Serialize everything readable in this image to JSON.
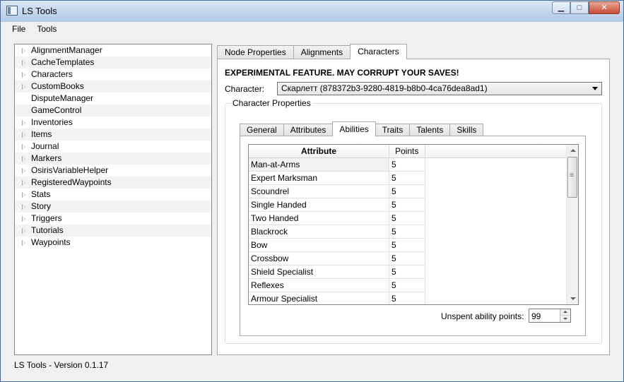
{
  "window": {
    "title": "LS Tools",
    "min_label": "▁",
    "max_label": "□",
    "close_label": "✕"
  },
  "menu": [
    "File",
    "Tools"
  ],
  "tree": [
    {
      "label": "AlignmentManager",
      "expandable": true
    },
    {
      "label": "CacheTemplates",
      "expandable": true
    },
    {
      "label": "Characters",
      "expandable": true
    },
    {
      "label": "CustomBooks",
      "expandable": true
    },
    {
      "label": "DisputeManager",
      "expandable": false
    },
    {
      "label": "GameControl",
      "expandable": false
    },
    {
      "label": "Inventories",
      "expandable": true
    },
    {
      "label": "Items",
      "expandable": true
    },
    {
      "label": "Journal",
      "expandable": true
    },
    {
      "label": "Markers",
      "expandable": true
    },
    {
      "label": "OsirisVariableHelper",
      "expandable": true
    },
    {
      "label": "RegisteredWaypoints",
      "expandable": true
    },
    {
      "label": "Stats",
      "expandable": true
    },
    {
      "label": "Story",
      "expandable": true
    },
    {
      "label": "Triggers",
      "expandable": true
    },
    {
      "label": "Tutorials",
      "expandable": true
    },
    {
      "label": "Waypoints",
      "expandable": true
    }
  ],
  "status": "LS Tools - Version 0.1.17",
  "tabs": [
    {
      "label": "Node Properties",
      "active": false
    },
    {
      "label": "Alignments",
      "active": false
    },
    {
      "label": "Characters",
      "active": true
    }
  ],
  "characters": {
    "warning": "EXPERIMENTAL FEATURE.  MAY CORRUPT YOUR SAVES!",
    "character_label": "Character:",
    "character_value": "Скарлетт (878372b3-9280-4819-b8b0-4ca76dea8ad1)",
    "group_title": "Character Properties",
    "subtabs": [
      {
        "label": "General",
        "active": false
      },
      {
        "label": "Attributes",
        "active": false
      },
      {
        "label": "Abilities",
        "active": true
      },
      {
        "label": "Traits",
        "active": false
      },
      {
        "label": "Talents",
        "active": false
      },
      {
        "label": "Skills",
        "active": false
      }
    ],
    "columns": {
      "attribute": "Attribute",
      "points": "Points"
    },
    "abilities": [
      {
        "name": "Man-at-Arms",
        "points": "5"
      },
      {
        "name": "Expert Marksman",
        "points": "5"
      },
      {
        "name": "Scoundrel",
        "points": "5"
      },
      {
        "name": "Single Handed",
        "points": "5"
      },
      {
        "name": "Two Handed",
        "points": "5"
      },
      {
        "name": "Blackrock",
        "points": "5"
      },
      {
        "name": "Bow",
        "points": "5"
      },
      {
        "name": "Crossbow",
        "points": "5"
      },
      {
        "name": "Shield Specialist",
        "points": "5"
      },
      {
        "name": "Reflexes",
        "points": "5"
      },
      {
        "name": "Armour Specialist",
        "points": "5"
      }
    ],
    "unspent_label": "Unspent ability points:",
    "unspent_value": "99"
  }
}
